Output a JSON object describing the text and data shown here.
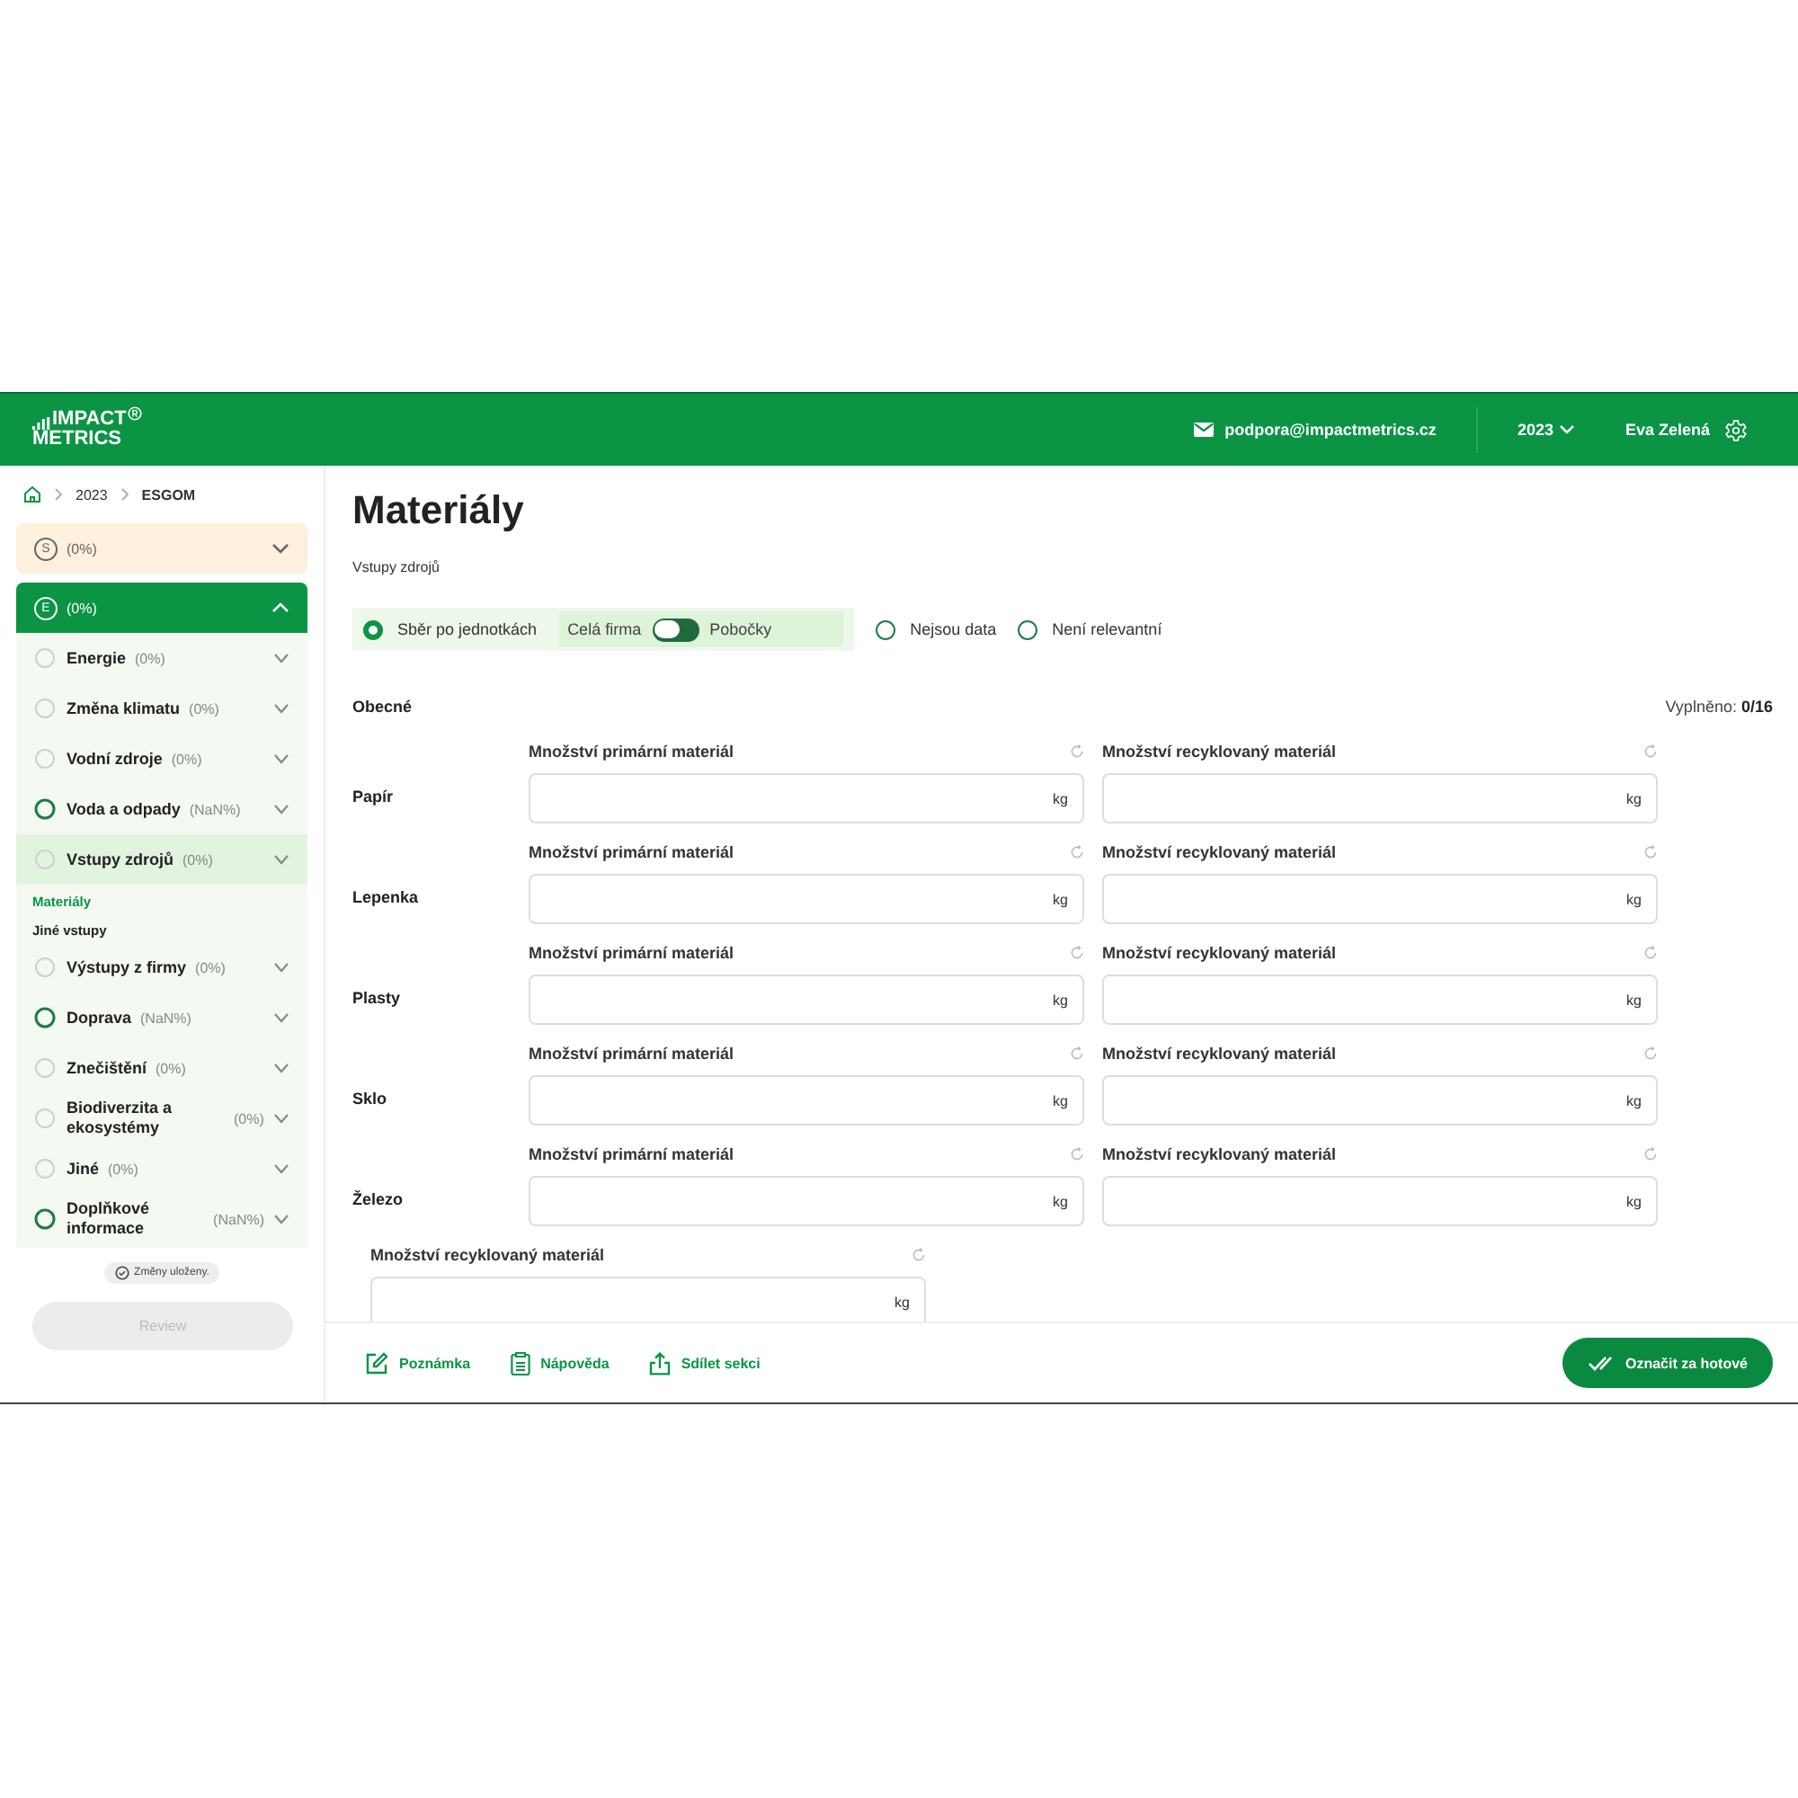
{
  "header": {
    "logo": {
      "line1": "IMPACT",
      "line2": "METRICS"
    },
    "email": "podpora@impactmetrics.cz",
    "year": "2023",
    "user": "Eva Zelená"
  },
  "breadcrumb": [
    "2023",
    "ESGOM"
  ],
  "sidebar": {
    "sections": [
      {
        "letter": "S",
        "percent": "(0%)",
        "expanded": false,
        "kind": "social"
      },
      {
        "letter": "E",
        "percent": "(0%)",
        "expanded": true,
        "kind": "environment",
        "items": [
          {
            "label": "Energie",
            "percent": "(0%)",
            "outlined": false,
            "selected": false
          },
          {
            "label": "Změna klimatu",
            "percent": "(0%)",
            "outlined": false,
            "selected": false
          },
          {
            "label": "Vodní zdroje",
            "percent": "(0%)",
            "outlined": false,
            "selected": false
          },
          {
            "label": "Voda a odpady",
            "percent": "(NaN%)",
            "outlined": true,
            "selected": false
          },
          {
            "label": "Vstupy zdrojů",
            "percent": "(0%)",
            "outlined": false,
            "selected": true,
            "children": [
              {
                "label": "Materiály",
                "selected": true
              },
              {
                "label": "Jiné vstupy",
                "selected": false
              }
            ]
          },
          {
            "label": "Výstupy z firmy",
            "percent": "(0%)",
            "outlined": false,
            "selected": false
          },
          {
            "label": "Doprava",
            "percent": "(NaN%)",
            "outlined": true,
            "selected": false
          },
          {
            "label": "Znečištění",
            "percent": "(0%)",
            "outlined": false,
            "selected": false
          },
          {
            "label": "Biodiverzita a ekosystémy",
            "percent": "(0%)",
            "outlined": false,
            "selected": false
          },
          {
            "label": "Jiné",
            "percent": "(0%)",
            "outlined": false,
            "selected": false
          },
          {
            "label": "Doplňkové informace",
            "percent": "(NaN%)",
            "outlined": true,
            "selected": false
          }
        ]
      }
    ],
    "save_status": "Změny uloženy.",
    "review_button": {
      "label": "Review",
      "disabled": true
    }
  },
  "main": {
    "title": "Materiály",
    "subtitle": "Vstupy zdrojů",
    "options": [
      {
        "label": "Sběr po jednotkách",
        "selected": true,
        "toggle": {
          "left": "Celá firma",
          "right": "Pobočky",
          "on": false
        }
      },
      {
        "label": "Nejsou data",
        "selected": false
      },
      {
        "label": "Není relevantní",
        "selected": false
      }
    ],
    "section": {
      "title": "Obecné",
      "progress": "Vyplněno: **0/16**"
    },
    "rows": [
      {
        "label": "Papír",
        "fields": [
          {
            "label": "Množství primární materiál",
            "unit": "kg"
          },
          {
            "label": "Množství recyklovaný materiál",
            "unit": "kg"
          }
        ]
      },
      {
        "label": "Lepenka",
        "fields": [
          {
            "label": "Množství primární materiál",
            "unit": "kg"
          },
          {
            "label": "Množství recyklovaný materiál",
            "unit": "kg"
          }
        ]
      },
      {
        "label": "Plasty",
        "fields": [
          {
            "label": "Množství primární materiál",
            "unit": "kg"
          },
          {
            "label": "Množství recyklovaný materiál",
            "unit": "kg"
          }
        ]
      },
      {
        "label": "Sklo",
        "fields": [
          {
            "label": "Množství primární materiál",
            "unit": "kg"
          },
          {
            "label": "Množství recyklovaný materiál",
            "unit": "kg"
          }
        ]
      },
      {
        "label": "Železo",
        "fields": [
          {
            "label": "Množství primární materiál",
            "unit": "kg"
          },
          {
            "label": "Množství recyklovaný materiál",
            "unit": "kg"
          }
        ]
      }
    ],
    "extra_fields": [
      {
        "label": "Množství recyklovaný materiál",
        "unit": "kg"
      }
    ],
    "footer": {
      "actions": [
        {
          "kind": "note",
          "label": "Poznámka"
        },
        {
          "kind": "help",
          "label": "Nápověda"
        },
        {
          "kind": "share",
          "label": "Sdílet sekci"
        }
      ],
      "done_button": "Označit za hotové"
    }
  }
}
